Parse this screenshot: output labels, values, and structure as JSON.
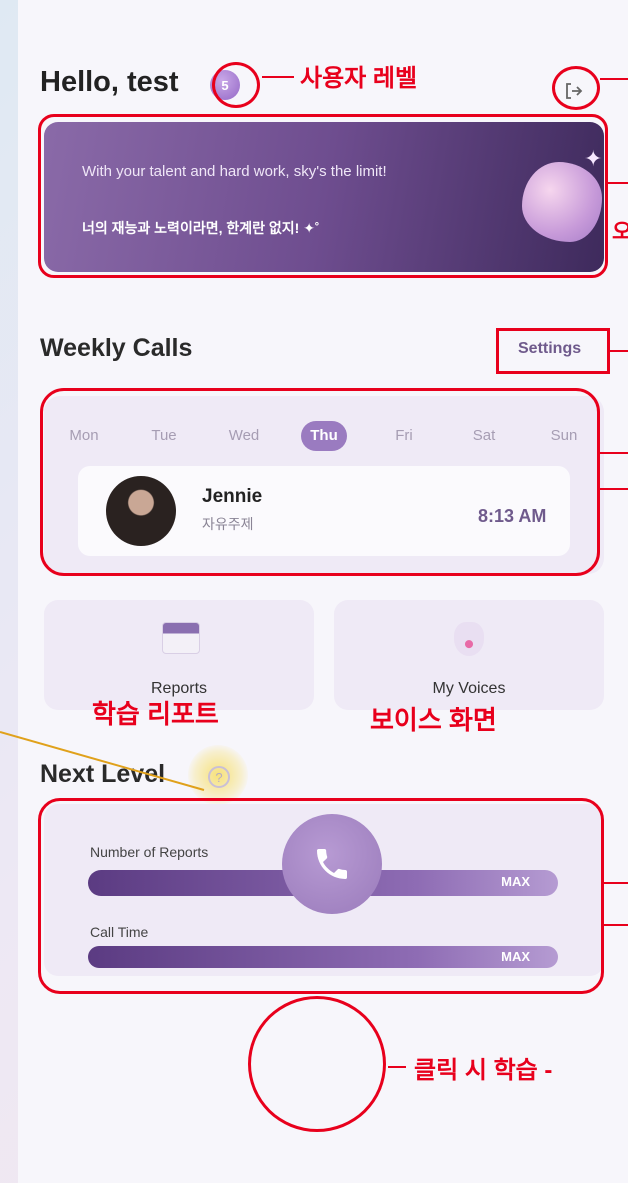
{
  "header": {
    "greeting": "Hello, test",
    "level": "5",
    "logout_icon": "logout-icon"
  },
  "banner": {
    "english": "With your talent and hard work, sky's the limit!",
    "korean": "너의 재능과 노력이라면, 한계란 없지! ✦˚"
  },
  "weekly_calls": {
    "title": "Weekly Calls",
    "settings": "Settings",
    "days": [
      {
        "label": "Mon",
        "active": false
      },
      {
        "label": "Tue",
        "active": false
      },
      {
        "label": "Wed",
        "active": false
      },
      {
        "label": "Thu",
        "active": true
      },
      {
        "label": "Fri",
        "active": false
      },
      {
        "label": "Sat",
        "active": false
      },
      {
        "label": "Sun",
        "active": false
      }
    ],
    "call": {
      "name": "Jennie",
      "topic": "자유주제",
      "time": "8:13 AM"
    }
  },
  "tiles": {
    "reports": "Reports",
    "my_voices": "My Voices"
  },
  "next_level": {
    "title": "Next Level",
    "items": [
      {
        "label": "Number of Reports",
        "value": "MAX"
      },
      {
        "label": "Call Time",
        "value": "MAX"
      }
    ]
  },
  "annotations": {
    "user_level": "사용자 레벨",
    "reports_label": "학습 리포트",
    "voices_label": "보이스 화면",
    "call_label": "클릭 시 학습 -",
    "cut_char": "오"
  },
  "colors": {
    "accent": "#9a7bc0",
    "annotation": "#e8001c"
  }
}
